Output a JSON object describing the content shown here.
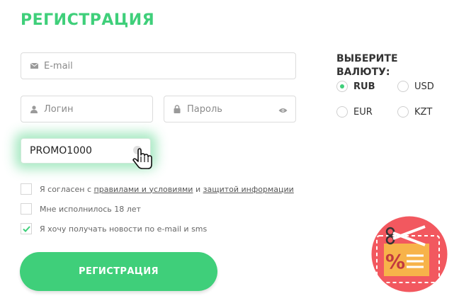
{
  "form": {
    "title": "РЕГИСТРАЦИЯ",
    "email_placeholder": "E-mail",
    "login_placeholder": "Логин",
    "password_placeholder": "Пароль",
    "promo_value": "PROMO1000",
    "icons": [
      "envelope-icon",
      "user-icon",
      "lock-icon",
      "eye-icon",
      "pointer-hand-icon"
    ]
  },
  "currency": {
    "label_line1": "ВЫБЕРИТЕ",
    "label_line2": "ВАЛЮТУ:",
    "options": [
      {
        "code": "RUB",
        "selected": true
      },
      {
        "code": "USD",
        "selected": false
      },
      {
        "code": "EUR",
        "selected": false
      },
      {
        "code": "KZT",
        "selected": false
      }
    ]
  },
  "checkboxes": {
    "terms_prefix": "Я согласен с",
    "terms_link": "правилами и условиями",
    "terms_and": "и",
    "privacy_link": "защитой информации",
    "terms_checked": false,
    "age_label": "Мне исполнилось 18 лет",
    "age_checked": false,
    "news_label": "Я хочу получать новости по e-mail и sms",
    "news_checked": true
  },
  "submit": {
    "label": "РЕГИСТРАЦИЯ"
  },
  "badge": {
    "glyph": "%",
    "icon": "coupon-scissors-icon"
  },
  "colors": {
    "accent": "#3fcf7a",
    "badge_bg": "#f2585f",
    "coupon": "#f7b34a",
    "text": "#333333"
  }
}
